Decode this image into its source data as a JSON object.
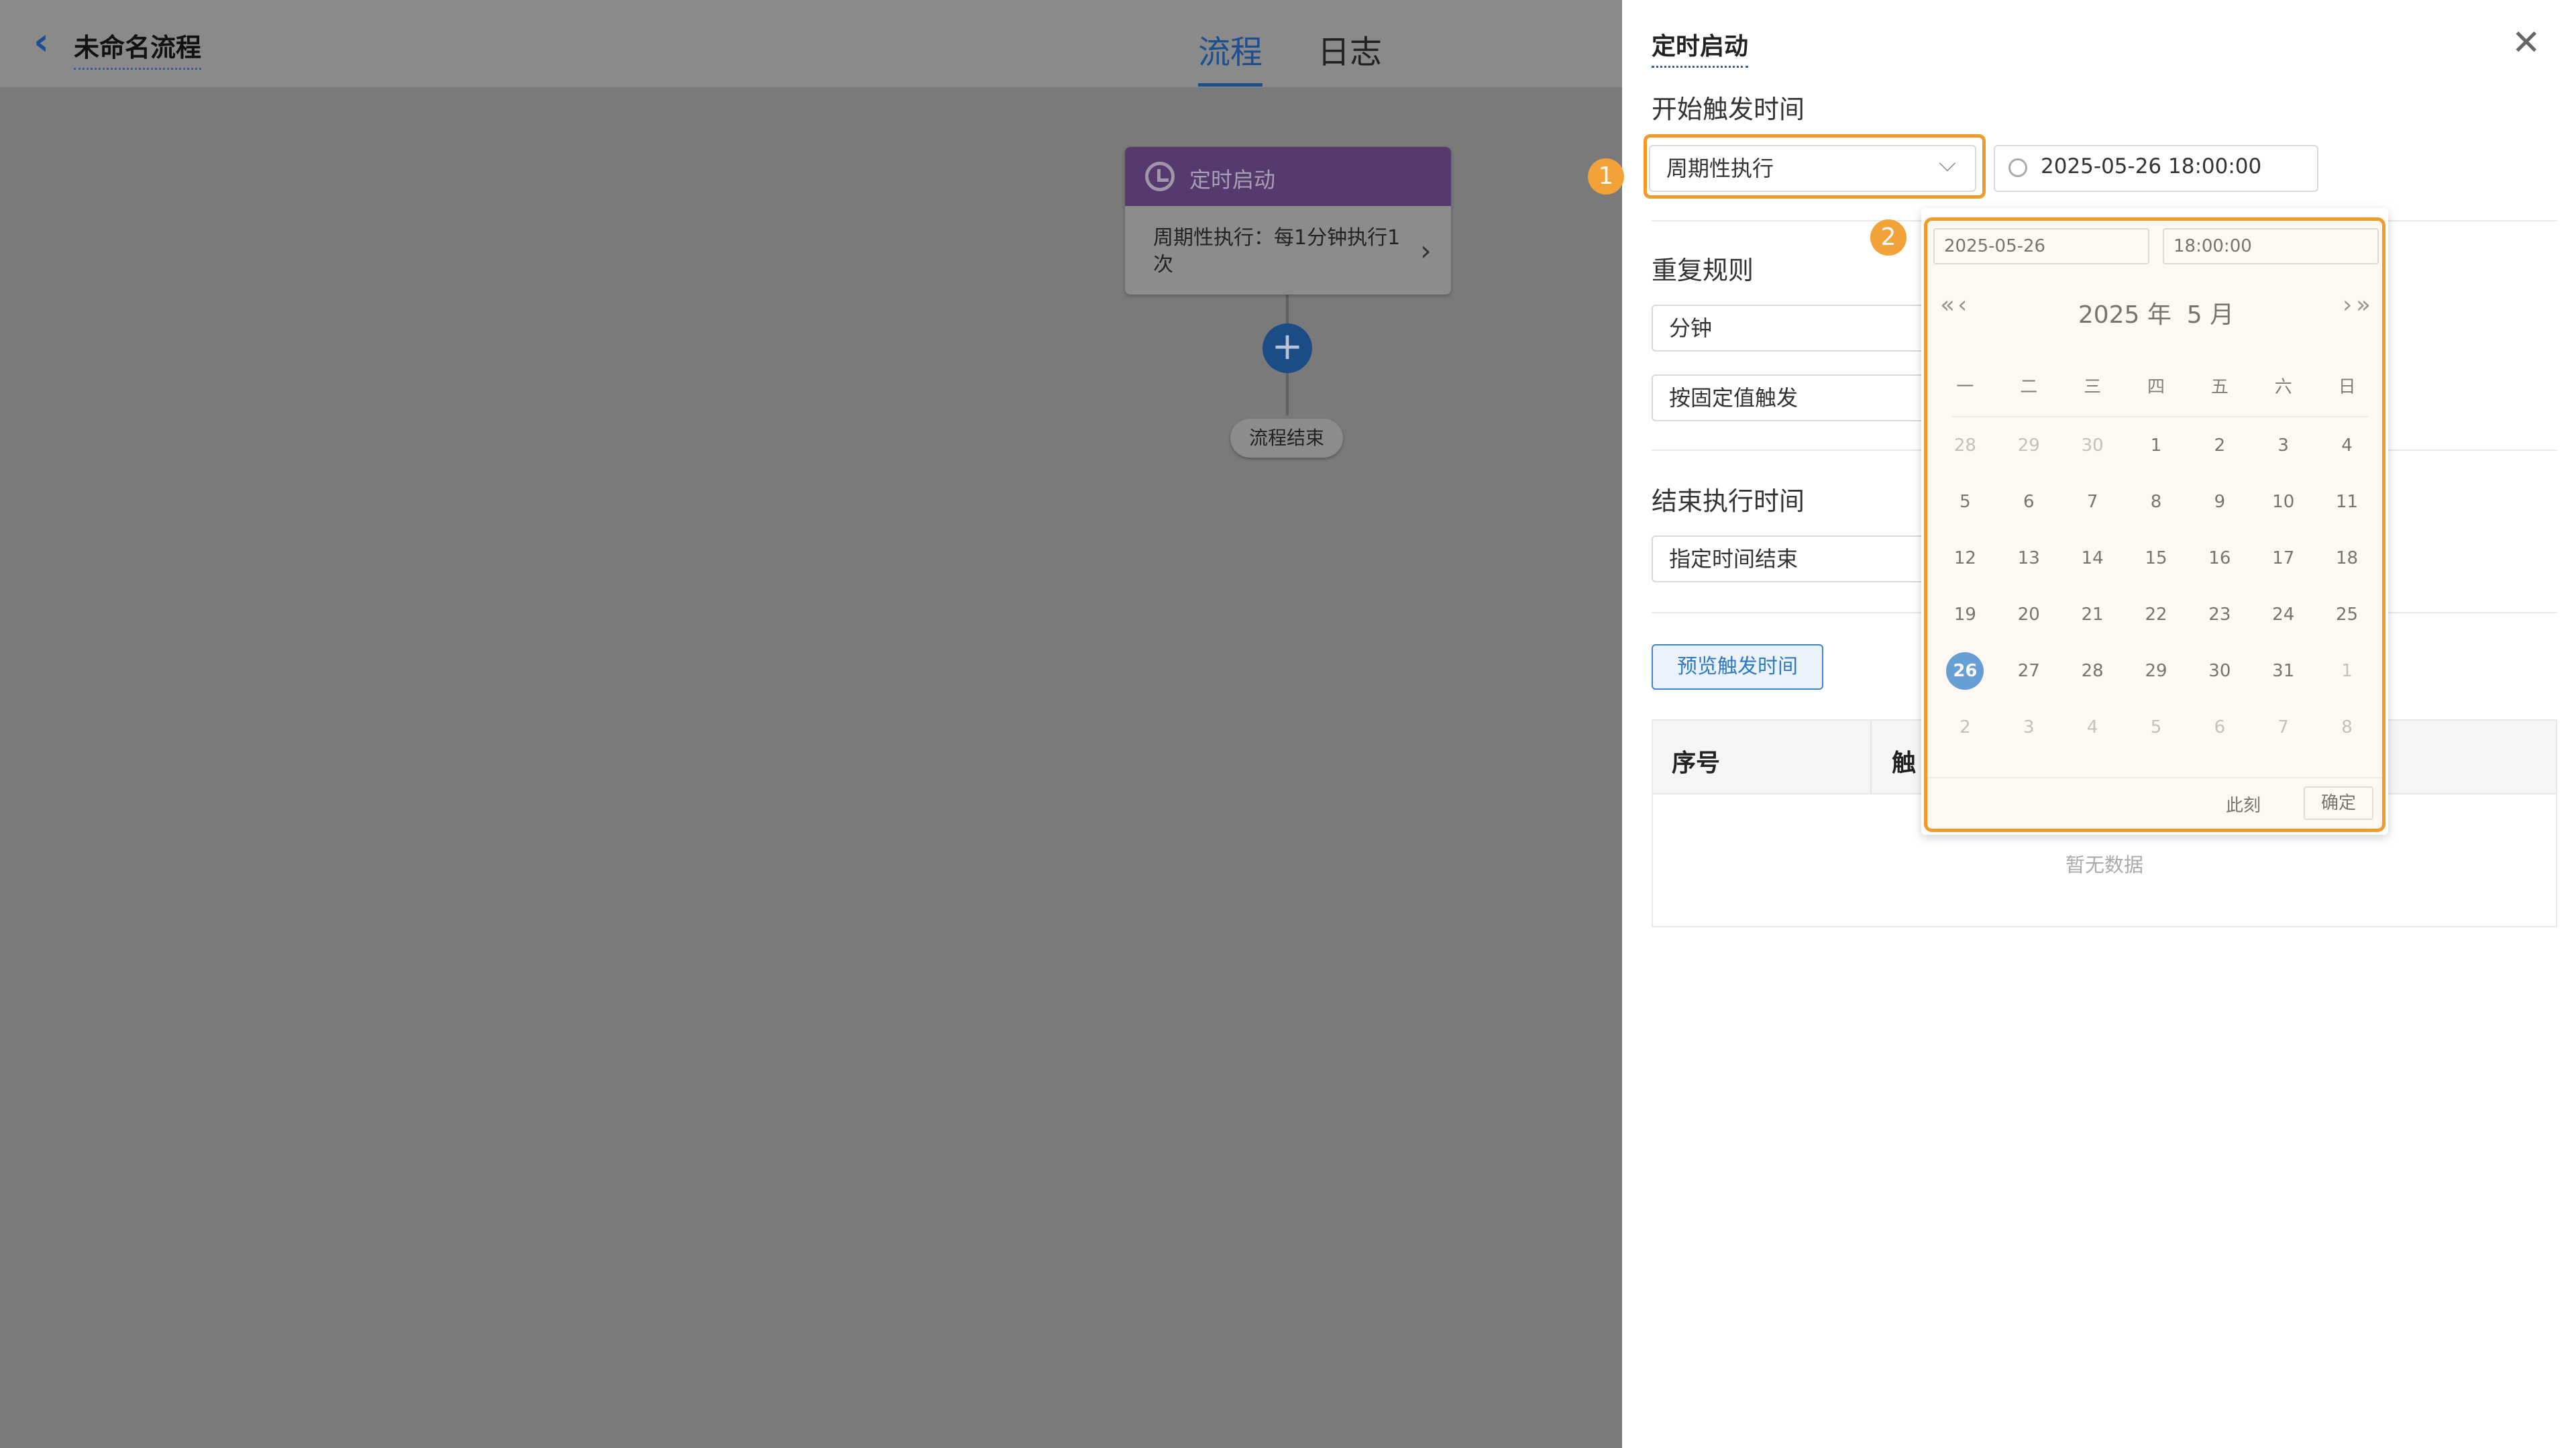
{
  "header": {
    "back_icon": "chevron-left-icon",
    "title": "未命名流程",
    "tabs": [
      {
        "label": "流程",
        "active": true
      },
      {
        "label": "日志",
        "active": false
      }
    ]
  },
  "flow": {
    "trigger_node": {
      "icon": "clock-icon",
      "title": "定时启动",
      "desc": "周期性执行：每1分钟执行1次"
    },
    "add_icon": "+",
    "end_node": "流程结束"
  },
  "panel": {
    "title": "定时启动",
    "start_section": "开始触发时间",
    "mode_select": "周期性执行",
    "datetime_value": "2025-05-26 18:00:00",
    "repeat_section": "重复规则",
    "repeat_unit": "分钟",
    "repeat_type": "按固定值触发",
    "end_section": "结束执行时间",
    "end_mode": "指定时间结束",
    "preview_button": "预览触发时间",
    "table": {
      "headers": [
        "序号",
        "触"
      ],
      "empty": "暂无数据"
    }
  },
  "badges": [
    "1",
    "2"
  ],
  "picker": {
    "date_input": "2025-05-26",
    "time_input": "18:00:00",
    "year_label": "2025 年",
    "month_label": "5 月",
    "nav": {
      "prev_year": "«",
      "prev_month": "‹",
      "next_month": "›",
      "next_year": "»"
    },
    "weekdays": [
      "一",
      "二",
      "三",
      "四",
      "五",
      "六",
      "日"
    ],
    "days": [
      {
        "d": "28",
        "m": true
      },
      {
        "d": "29",
        "m": true
      },
      {
        "d": "30",
        "m": true
      },
      {
        "d": "1"
      },
      {
        "d": "2"
      },
      {
        "d": "3"
      },
      {
        "d": "4"
      },
      {
        "d": "5"
      },
      {
        "d": "6"
      },
      {
        "d": "7"
      },
      {
        "d": "8"
      },
      {
        "d": "9"
      },
      {
        "d": "10"
      },
      {
        "d": "11"
      },
      {
        "d": "12"
      },
      {
        "d": "13"
      },
      {
        "d": "14"
      },
      {
        "d": "15"
      },
      {
        "d": "16"
      },
      {
        "d": "17"
      },
      {
        "d": "18"
      },
      {
        "d": "19"
      },
      {
        "d": "20"
      },
      {
        "d": "21"
      },
      {
        "d": "22"
      },
      {
        "d": "23"
      },
      {
        "d": "24"
      },
      {
        "d": "25"
      },
      {
        "d": "26",
        "s": true
      },
      {
        "d": "27"
      },
      {
        "d": "28"
      },
      {
        "d": "29"
      },
      {
        "d": "30"
      },
      {
        "d": "31"
      },
      {
        "d": "1",
        "m": true
      },
      {
        "d": "2",
        "m": true
      },
      {
        "d": "3",
        "m": true
      },
      {
        "d": "4",
        "m": true
      },
      {
        "d": "5",
        "m": true
      },
      {
        "d": "6",
        "m": true
      },
      {
        "d": "7",
        "m": true
      },
      {
        "d": "8",
        "m": true
      }
    ],
    "now_button": "此刻",
    "ok_button": "确定"
  },
  "colors": {
    "accent": "#1976d2",
    "highlight": "#f19a29",
    "node_header": "#55396f"
  }
}
